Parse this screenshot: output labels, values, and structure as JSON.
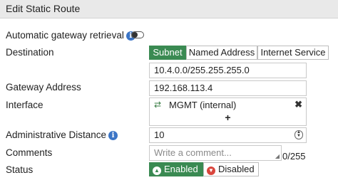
{
  "header": {
    "title": "Edit Static Route"
  },
  "auto_gateway": {
    "label": "Automatic gateway retrieval",
    "info_icon": "info-icon",
    "enabled": false
  },
  "destination": {
    "label": "Destination",
    "tabs": [
      {
        "label": "Subnet",
        "selected": true
      },
      {
        "label": "Named Address",
        "selected": false
      },
      {
        "label": "Internet Service",
        "selected": false
      }
    ],
    "value": "10.4.0.0/255.255.255.0"
  },
  "gateway": {
    "label": "Gateway Address",
    "value": "192.168.113.4"
  },
  "interface": {
    "label": "Interface",
    "item": "MGMT (internal)",
    "item_icon": "port-icon",
    "remove_icon": "close-icon",
    "add_symbol": "+"
  },
  "distance": {
    "label": "Administrative Distance",
    "info_icon": "info-icon",
    "value": "10"
  },
  "comments": {
    "label": "Comments",
    "placeholder": "Write a comment...",
    "counter": "0/255"
  },
  "status": {
    "label": "Status",
    "options": [
      {
        "label": "Enabled",
        "icon": "arrow-up-icon",
        "selected": true
      },
      {
        "label": "Disabled",
        "icon": "arrow-down-icon",
        "selected": false
      }
    ]
  },
  "colors": {
    "accent": "#3a8a52",
    "info": "#3b75c6",
    "danger": "#d9453c"
  }
}
